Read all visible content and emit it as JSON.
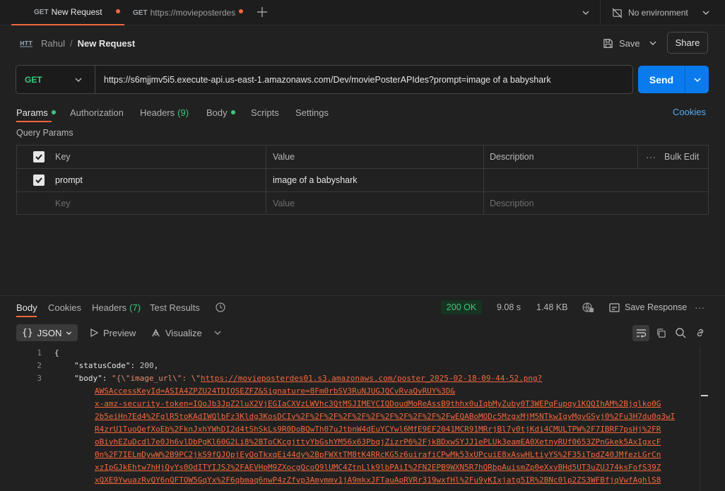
{
  "tabs": [
    {
      "method": "GET",
      "label": "New Request"
    },
    {
      "method": "GET",
      "label": "https://movieposterdes"
    }
  ],
  "environment": "No environment",
  "breadcrumb": {
    "workspace": "Rahul",
    "separator": "/",
    "request": "New Request"
  },
  "actions": {
    "save": "Save",
    "share": "Share"
  },
  "request": {
    "method": "GET",
    "url": "https://s6mjjmv5i5.execute-api.us-east-1.amazonaws.com/Dev/moviePosterAPIdes?prompt=image of a babyshark",
    "send": "Send"
  },
  "request_tabs": {
    "params": "Params",
    "authorization": "Authorization",
    "headers": "Headers",
    "headers_count": "(9)",
    "body": "Body",
    "scripts": "Scripts",
    "settings": "Settings",
    "cookies": "Cookies"
  },
  "query_params": {
    "title": "Query Params",
    "columns": {
      "key": "Key",
      "value": "Value",
      "description": "Description",
      "bulk_edit": "Bulk Edit"
    },
    "rows": [
      {
        "checked": true,
        "key": "prompt",
        "value": "image of a babyshark",
        "description": ""
      }
    ],
    "placeholder": {
      "key": "Key",
      "value": "Value",
      "description": "Description"
    }
  },
  "response_tabs": {
    "body": "Body",
    "cookies": "Cookies",
    "headers": "Headers",
    "headers_count": "(7)",
    "test_results": "Test Results"
  },
  "response_meta": {
    "status": "200 OK",
    "time": "9.08 s",
    "size": "1.48 KB",
    "save_response": "Save Response"
  },
  "viewer": {
    "format": "JSON",
    "preview": "Preview",
    "visualize": "Visualize"
  },
  "code_lines": {
    "l1": "{",
    "l2_key": "\"statusCode\"",
    "l2_val": "200",
    "l3_key": "\"body\"",
    "l3_pre": "\"{\\\"image_url\\\": \\\"",
    "l3_url": "https://movieposterdes01.s3.amazonaws.com/poster_2025-02-18-09-44-52.png?",
    "w1": "AWSAccessKeyId=ASIA4ZPZU24TDIOSEZFZ&Signature=8Fm0rbSV3RuNJUGJQCvRvaQvRUY%3D&",
    "w2": "x-amz-security-token=IQoJb3JpZ2luX2VjEGIaCXVzLWVhc3QtMSJIMEYCIQDoudMoReAssB9thhx0uIqbMyZuby0T3WEPqFupqy1KQQIhAM%2Bjglko0G",
    "w3": "2b5eiHn7Ed4%2FglR5toKAdIWQlbFz3Kldg3KosDCIv%2F%2F%2F%2F%2F%2F%2F%2F%2F%2F%2FwEQABoMODc5MzgxMjM5NTkwIgyMgvGSyj0%2Fu3H7du0q3wI",
    "w4": "R4zrU1TuoQefXoEb%2FknJxhYWhDI2d4tShSkLs9R0DoBQwTh07uJtbnW4dEuYCYwl6MfE9EF2041MCR91MRrjBl7y0tjKdi4CMULTPW%2F7IBRF7psHj%2FR",
    "w5": "oBivhEZuDcdl7e0Jh6vlDbPgKl60G2Li8%2BToCKcgjttyYbGshYM56x63PbqjZizrP6%2FjkBDxwSYJJ1ePLUk3eamEA0XetnyRUf0653ZPnGkek5AxIgxcF",
    "w6": "0n%2F7IELmDywW%2B9PC2jkS9fQJOpjEyQoTkxqEi44dy%2BpFWXtTM8tK4RRcKG5z6uirafiCPwMk53xUPcuiE8xAswHLtiyYS%2F35iTpdZ40JMfezLGrCn",
    "w7": "xzIpGJkEhtw7hHjQyYs0OdITYIJSJ%2FAEVHpM9ZXocgQcoQ9lUMC4ZtnLlk9lbPAiI%2FN2EPB9WXN5R7hQRbpAuismZp0eXxvBHd5UT3uZUJ74ksFofS39Z",
    "w8": "xQXE9YwuazRvQY6nQFTOW5GqYx%2F6qbmaq6nwP4zZfvp3Amymmv1jA9mkxJFTauApRVRr319wxfHl%2Fu9yKIxjatg5IR%2BNc0lp2ZS3WFBfjqVwfAghlS8"
  }
}
